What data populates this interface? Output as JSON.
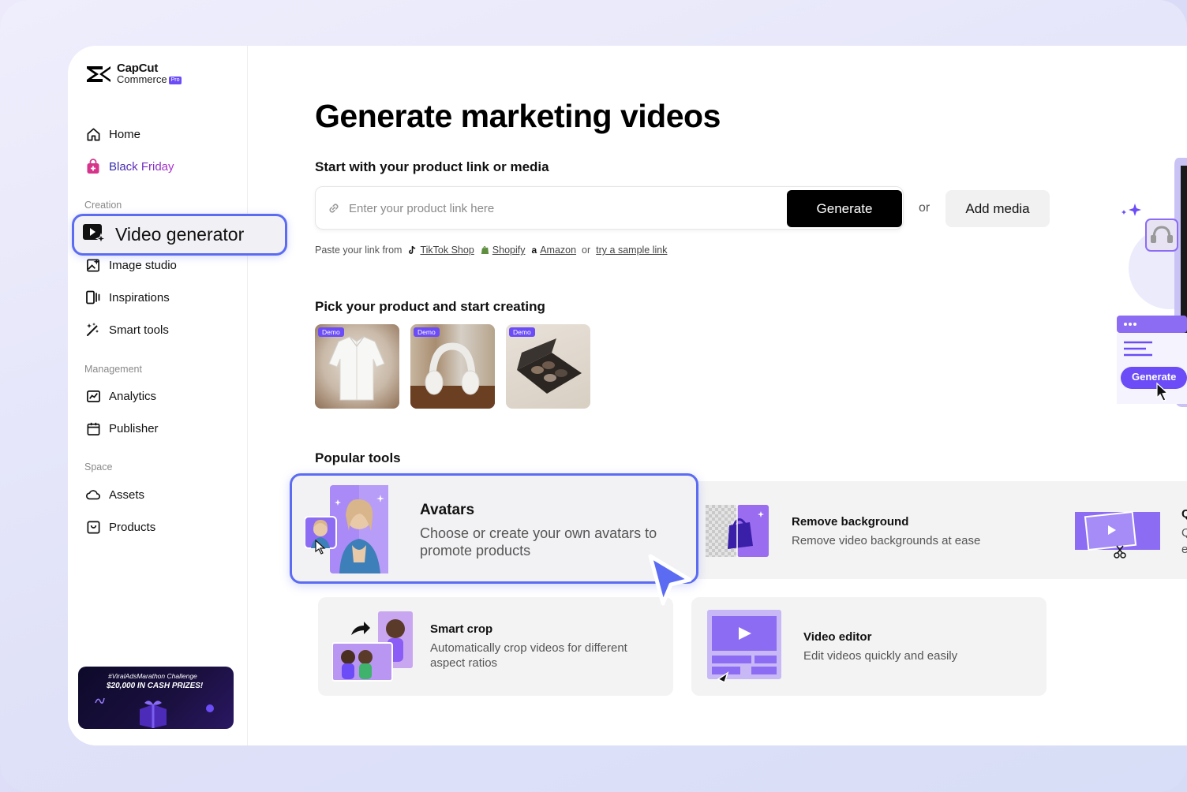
{
  "brand": {
    "line1": "CapCut",
    "line2": "Commerce",
    "badge": "Pro"
  },
  "sidebar": {
    "home": "Home",
    "black_friday": "Black Friday",
    "section_creation": "Creation",
    "video_generator": "Video generator",
    "image_studio": "Image studio",
    "inspirations": "Inspirations",
    "smart_tools": "Smart tools",
    "section_management": "Management",
    "analytics": "Analytics",
    "publisher": "Publisher",
    "section_space": "Space",
    "assets": "Assets",
    "products": "Products",
    "promo_line1": "#ViralAdsMarathon Challenge",
    "promo_line2": "$20,000 IN CASH PRIZES!"
  },
  "main": {
    "title": "Generate marketing videos",
    "start_heading": "Start with your product link or media",
    "link_placeholder": "Enter your product link here",
    "generate_label": "Generate",
    "or_label": "or",
    "add_media_label": "Add media",
    "paste_prefix": "Paste your link from",
    "sources": [
      "TikTok Shop",
      "Shopify",
      "Amazon"
    ],
    "paste_or": "or",
    "sample_link": "try a sample link",
    "pick_heading": "Pick your product and start creating",
    "demo_tag": "Demo",
    "popular_heading": "Popular tools"
  },
  "tools": {
    "avatars": {
      "name": "Avatars",
      "desc": "Choose or create your own avatars to promote products"
    },
    "remove_bg": {
      "name": "Remove background",
      "desc": "Remove video backgrounds at ease"
    },
    "partial": {
      "name": "Q",
      "desc1": "Qu",
      "desc2": "ec"
    },
    "smart_crop": {
      "name": "Smart crop",
      "desc": "Automatically crop videos for different aspect ratios"
    },
    "video_editor": {
      "name": "Video editor",
      "desc": "Edit videos quickly and easily"
    }
  },
  "preview": {
    "generate_label": "Generate"
  },
  "colors": {
    "accent": "#6b4cf6",
    "highlight": "#5b6cf2",
    "black": "#000000"
  }
}
